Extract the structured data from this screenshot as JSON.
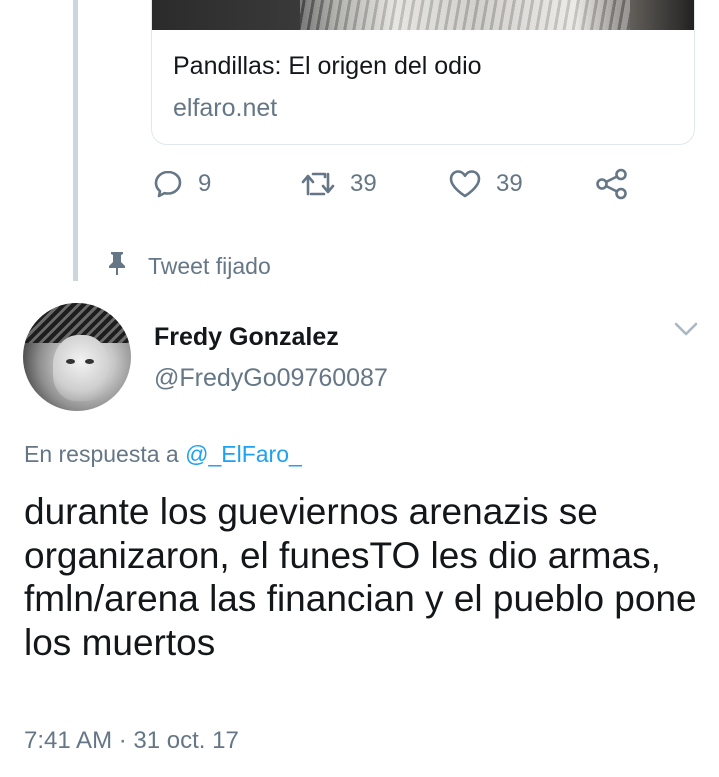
{
  "link_card": {
    "title": "Pandillas: El origen del odio",
    "domain": "elfaro.net"
  },
  "actions": {
    "reply": {
      "icon": "reply-icon",
      "count": "9"
    },
    "retweet": {
      "icon": "retweet-icon",
      "count": "39"
    },
    "like": {
      "icon": "heart-icon",
      "count": "39"
    },
    "share": {
      "icon": "share-icon"
    }
  },
  "pinned_label": "Tweet fijado",
  "tweet": {
    "author_name": "Fredy Gonzalez",
    "handle": "@FredyGo09760087",
    "reply_prefix": "En respuesta a ",
    "reply_mention": "@_ElFaro_",
    "text": "durante los gueviernos arenazis se organizaron, el funesTO les dio armas, fmln/arena las financian y el pueblo pone los muertos",
    "timestamp": "7:41 AM · 31 oct. 17"
  },
  "colors": {
    "text": "#14171a",
    "secondary": "#657786",
    "accent": "#1da1f2",
    "thread_line": "#ccd6dd"
  }
}
